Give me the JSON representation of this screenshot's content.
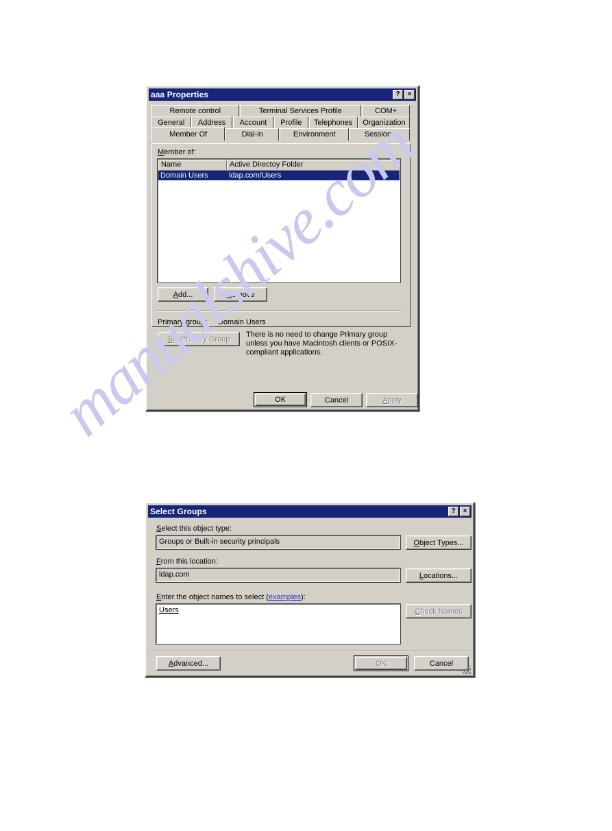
{
  "page": {
    "watermark": "manualshive.com",
    "watermark_color": "#c9c9ef",
    "background": "#ffffff"
  },
  "colors": {
    "titlebar": "#16247a",
    "dialog_face": "#d4d0c8",
    "selection": "#16247a",
    "link": "#3333cc",
    "disabled_text": "#808080"
  },
  "properties_dialog": {
    "title": "aaa Properties",
    "titlebar_buttons": [
      {
        "name": "help-button",
        "glyph": "?"
      },
      {
        "name": "close-button",
        "glyph": "×"
      }
    ],
    "tab_rows": [
      [
        {
          "label": "Remote control",
          "active": false
        },
        {
          "label": "Terminal Services Profile",
          "active": false
        },
        {
          "label": "COM+",
          "active": false
        }
      ],
      [
        {
          "label": "General",
          "active": false
        },
        {
          "label": "Address",
          "active": false
        },
        {
          "label": "Account",
          "active": false
        },
        {
          "label": "Profile",
          "active": false
        },
        {
          "label": "Telephones",
          "active": false
        },
        {
          "label": "Organization",
          "active": false
        }
      ],
      [
        {
          "label": "Member Of",
          "active": true
        },
        {
          "label": "Dial-in",
          "active": false
        },
        {
          "label": "Environment",
          "active": false
        },
        {
          "label": "Sessions",
          "active": false
        }
      ]
    ],
    "member_of": {
      "group_label": "Member of:",
      "columns": [
        "Name",
        "Active Directoy Folder"
      ],
      "rows": [
        {
          "name": "Domain Users",
          "folder": "ldap.com/Users",
          "selected": true
        }
      ]
    },
    "list_buttons": [
      {
        "label": "Add...",
        "name": "add-button",
        "disabled": false
      },
      {
        "label": "Remove",
        "name": "remove-button",
        "disabled": false
      }
    ],
    "primary_group": {
      "label": "Primary group:",
      "value": "Domain Users",
      "set_button_label": "Set Primary Group",
      "set_button_disabled": true,
      "description": "There is no need to change Primary group unless you have Macintosh clients or POSIX-compliant applications."
    },
    "footer_buttons": [
      {
        "label": "OK",
        "name": "ok-button",
        "disabled": false,
        "default": true
      },
      {
        "label": "Cancel",
        "name": "cancel-button",
        "disabled": false,
        "default": false
      },
      {
        "label": "Apply",
        "name": "apply-button",
        "disabled": true,
        "default": false
      }
    ]
  },
  "select_groups_dialog": {
    "title": "Select Groups",
    "titlebar_buttons": [
      {
        "name": "help-button",
        "glyph": "?"
      },
      {
        "name": "close-button",
        "glyph": "×"
      }
    ],
    "object_type": {
      "label": "Select this object type:",
      "value": "Groups or Built-in security principals",
      "button_label": "Object Types..."
    },
    "location": {
      "label": "From this location:",
      "value": "ldap.com",
      "button_label": "Locations..."
    },
    "object_names": {
      "label_prefix": "Enter the object names to select (",
      "label_link": "examples",
      "label_suffix": "):",
      "value": "Users",
      "check_names_label": "Check Names",
      "check_names_disabled": true
    },
    "footer_buttons": [
      {
        "label": "Advanced...",
        "name": "advanced-button",
        "disabled": false,
        "default": false
      },
      {
        "label": "OK",
        "name": "ok-button",
        "disabled": true,
        "default": true
      },
      {
        "label": "Cancel",
        "name": "cancel-button",
        "disabled": false,
        "default": false
      }
    ]
  }
}
